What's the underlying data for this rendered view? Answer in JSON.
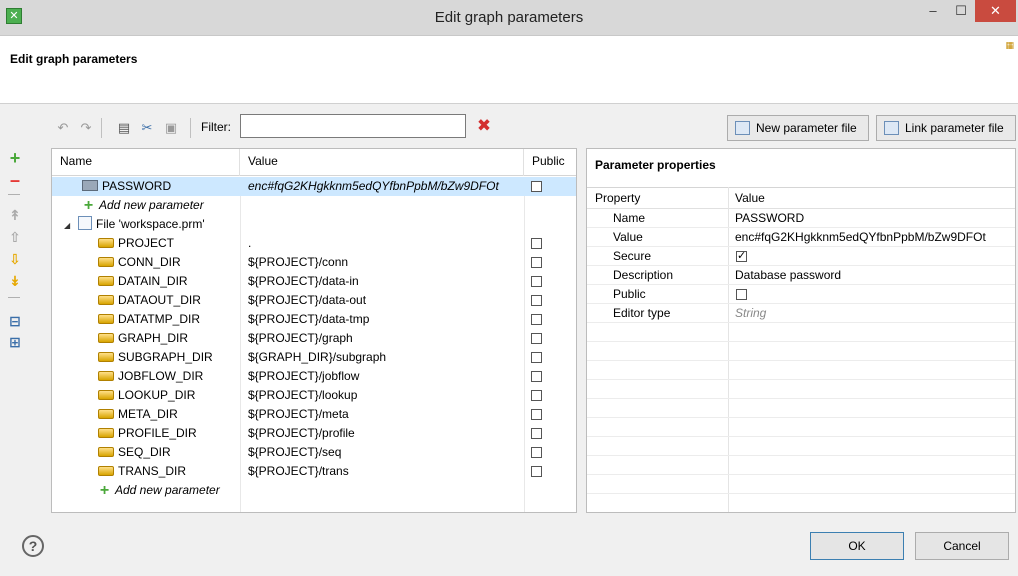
{
  "window": {
    "title": "Edit graph parameters",
    "app_icon": "✕",
    "min_glyph": "–",
    "max_glyph": "☐",
    "close_glyph": "✕"
  },
  "header": {
    "title": "Edit graph parameters"
  },
  "toolbar": {
    "filter_label": "Filter:",
    "filter_value": "",
    "new_param_file_label": "New parameter file",
    "link_param_file_label": "Link parameter file"
  },
  "table": {
    "columns": [
      "Name",
      "Value",
      "Public"
    ],
    "rows": [
      {
        "kind": "secure",
        "name": "PASSWORD",
        "value": "enc#fqG2KHgkknm5edQYfbnPpbM/bZw9DFOt",
        "public": false,
        "selected": true
      },
      {
        "kind": "add",
        "name": "Add new parameter",
        "value": ""
      },
      {
        "kind": "file",
        "name": "File 'workspace.prm'",
        "value": ""
      },
      {
        "kind": "param",
        "name": "PROJECT",
        "value": ".",
        "public": false
      },
      {
        "kind": "param",
        "name": "CONN_DIR",
        "value": "${PROJECT}/conn",
        "public": false
      },
      {
        "kind": "param",
        "name": "DATAIN_DIR",
        "value": "${PROJECT}/data-in",
        "public": false
      },
      {
        "kind": "param",
        "name": "DATAOUT_DIR",
        "value": "${PROJECT}/data-out",
        "public": false
      },
      {
        "kind": "param",
        "name": "DATATMP_DIR",
        "value": "${PROJECT}/data-tmp",
        "public": false
      },
      {
        "kind": "param",
        "name": "GRAPH_DIR",
        "value": "${PROJECT}/graph",
        "public": false
      },
      {
        "kind": "param",
        "name": "SUBGRAPH_DIR",
        "value": "${GRAPH_DIR}/subgraph",
        "public": false
      },
      {
        "kind": "param",
        "name": "JOBFLOW_DIR",
        "value": "${PROJECT}/jobflow",
        "public": false
      },
      {
        "kind": "param",
        "name": "LOOKUP_DIR",
        "value": "${PROJECT}/lookup",
        "public": false
      },
      {
        "kind": "param",
        "name": "META_DIR",
        "value": "${PROJECT}/meta",
        "public": false
      },
      {
        "kind": "param",
        "name": "PROFILE_DIR",
        "value": "${PROJECT}/profile",
        "public": false
      },
      {
        "kind": "param",
        "name": "SEQ_DIR",
        "value": "${PROJECT}/seq",
        "public": false
      },
      {
        "kind": "param",
        "name": "TRANS_DIR",
        "value": "${PROJECT}/trans",
        "public": false
      },
      {
        "kind": "add-nested",
        "name": "Add new parameter",
        "value": ""
      }
    ]
  },
  "properties": {
    "title": "Parameter properties",
    "columns": [
      "Property",
      "Value"
    ],
    "rows": [
      {
        "name": "Name",
        "value": "PASSWORD",
        "type": "text"
      },
      {
        "name": "Value",
        "value": "enc#fqG2KHgkknm5edQYfbnPpbM/bZw9DFOt",
        "type": "text"
      },
      {
        "name": "Secure",
        "value": "",
        "type": "checkbox",
        "checked": true
      },
      {
        "name": "Description",
        "value": "Database password",
        "type": "text"
      },
      {
        "name": "Public",
        "value": "",
        "type": "checkbox",
        "checked": false
      },
      {
        "name": "Editor type",
        "value": "String",
        "type": "placeholder"
      }
    ]
  },
  "footer": {
    "help": "?",
    "ok_label": "OK",
    "cancel_label": "Cancel"
  }
}
